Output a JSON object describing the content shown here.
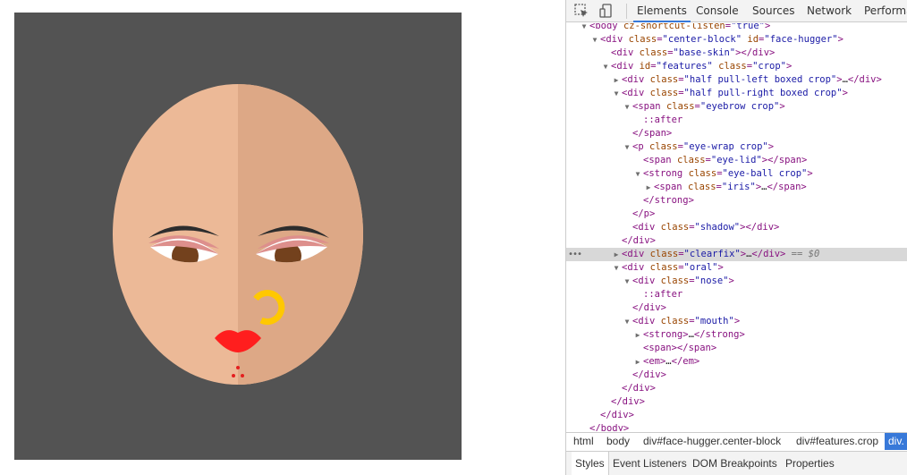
{
  "devtools": {
    "tabs": [
      {
        "label": "Elements",
        "active": true
      },
      {
        "label": "Console"
      },
      {
        "label": "Sources"
      },
      {
        "label": "Network"
      },
      {
        "label": "Performa"
      }
    ],
    "tree": [
      {
        "depth": 0,
        "arrow": "down",
        "parts": [
          [
            "tg",
            "<body "
          ],
          [
            "an",
            "cz-shortcut-listen"
          ],
          [
            "tg",
            "="
          ],
          [
            "av",
            "\"true\""
          ],
          [
            "tg",
            ">"
          ]
        ]
      },
      {
        "depth": 1,
        "arrow": "down",
        "parts": [
          [
            "tg",
            "<div "
          ],
          [
            "an",
            "class"
          ],
          [
            "tg",
            "="
          ],
          [
            "av",
            "\"center-block\""
          ],
          [
            "tg",
            " "
          ],
          [
            "an",
            "id"
          ],
          [
            "tg",
            "="
          ],
          [
            "av",
            "\"face-hugger\""
          ],
          [
            "tg",
            ">"
          ]
        ]
      },
      {
        "depth": 2,
        "arrow": "",
        "parts": [
          [
            "tg",
            "<div "
          ],
          [
            "an",
            "class"
          ],
          [
            "tg",
            "="
          ],
          [
            "av",
            "\"base-skin\""
          ],
          [
            "tg",
            "></div>"
          ]
        ]
      },
      {
        "depth": 2,
        "arrow": "down",
        "parts": [
          [
            "tg",
            "<div "
          ],
          [
            "an",
            "id"
          ],
          [
            "tg",
            "="
          ],
          [
            "av",
            "\"features\""
          ],
          [
            "tg",
            " "
          ],
          [
            "an",
            "class"
          ],
          [
            "tg",
            "="
          ],
          [
            "av",
            "\"crop\""
          ],
          [
            "tg",
            ">"
          ]
        ]
      },
      {
        "depth": 3,
        "arrow": "right",
        "parts": [
          [
            "tg",
            "<div "
          ],
          [
            "an",
            "class"
          ],
          [
            "tg",
            "="
          ],
          [
            "av",
            "\"half pull-left boxed crop\""
          ],
          [
            "tg",
            ">"
          ],
          [
            "pl",
            "…"
          ],
          [
            "tg",
            "</div>"
          ]
        ]
      },
      {
        "depth": 3,
        "arrow": "down",
        "parts": [
          [
            "tg",
            "<div "
          ],
          [
            "an",
            "class"
          ],
          [
            "tg",
            "="
          ],
          [
            "av",
            "\"half pull-right boxed crop\""
          ],
          [
            "tg",
            ">"
          ]
        ]
      },
      {
        "depth": 4,
        "arrow": "down",
        "parts": [
          [
            "tg",
            "<span "
          ],
          [
            "an",
            "class"
          ],
          [
            "tg",
            "="
          ],
          [
            "av",
            "\"eyebrow crop\""
          ],
          [
            "tg",
            ">"
          ]
        ]
      },
      {
        "depth": 5,
        "arrow": "",
        "parts": [
          [
            "ps",
            "::after"
          ]
        ]
      },
      {
        "depth": 4,
        "arrow": "",
        "parts": [
          [
            "tg",
            "</span>"
          ]
        ]
      },
      {
        "depth": 4,
        "arrow": "down",
        "parts": [
          [
            "tg",
            "<p "
          ],
          [
            "an",
            "class"
          ],
          [
            "tg",
            "="
          ],
          [
            "av",
            "\"eye-wrap crop\""
          ],
          [
            "tg",
            ">"
          ]
        ]
      },
      {
        "depth": 5,
        "arrow": "",
        "parts": [
          [
            "tg",
            "<span "
          ],
          [
            "an",
            "class"
          ],
          [
            "tg",
            "="
          ],
          [
            "av",
            "\"eye-lid\""
          ],
          [
            "tg",
            "></span>"
          ]
        ]
      },
      {
        "depth": 5,
        "arrow": "down",
        "parts": [
          [
            "tg",
            "<strong "
          ],
          [
            "an",
            "class"
          ],
          [
            "tg",
            "="
          ],
          [
            "av",
            "\"eye-ball crop\""
          ],
          [
            "tg",
            ">"
          ]
        ]
      },
      {
        "depth": 6,
        "arrow": "right",
        "parts": [
          [
            "tg",
            "<span "
          ],
          [
            "an",
            "class"
          ],
          [
            "tg",
            "="
          ],
          [
            "av",
            "\"iris\""
          ],
          [
            "tg",
            ">"
          ],
          [
            "pl",
            "…"
          ],
          [
            "tg",
            "</span>"
          ]
        ]
      },
      {
        "depth": 5,
        "arrow": "",
        "parts": [
          [
            "tg",
            "</strong>"
          ]
        ]
      },
      {
        "depth": 4,
        "arrow": "",
        "parts": [
          [
            "tg",
            "</p>"
          ]
        ]
      },
      {
        "depth": 4,
        "arrow": "",
        "parts": [
          [
            "tg",
            "<div "
          ],
          [
            "an",
            "class"
          ],
          [
            "tg",
            "="
          ],
          [
            "av",
            "\"shadow\""
          ],
          [
            "tg",
            "></div>"
          ]
        ]
      },
      {
        "depth": 3,
        "arrow": "",
        "parts": [
          [
            "tg",
            "</div>"
          ]
        ]
      },
      {
        "depth": 3,
        "arrow": "right",
        "selected": true,
        "parts": [
          [
            "tg",
            "<div "
          ],
          [
            "an",
            "class"
          ],
          [
            "tg",
            "="
          ],
          [
            "av",
            "\"clearfix\""
          ],
          [
            "tg",
            ">"
          ],
          [
            "pl",
            "…"
          ],
          [
            "tg",
            "</div>"
          ],
          [
            "pl",
            " == "
          ],
          [
            "pl",
            "$0"
          ]
        ]
      },
      {
        "depth": 3,
        "arrow": "down",
        "parts": [
          [
            "tg",
            "<div "
          ],
          [
            "an",
            "class"
          ],
          [
            "tg",
            "="
          ],
          [
            "av",
            "\"oral\""
          ],
          [
            "tg",
            ">"
          ]
        ]
      },
      {
        "depth": 4,
        "arrow": "down",
        "parts": [
          [
            "tg",
            "<div "
          ],
          [
            "an",
            "class"
          ],
          [
            "tg",
            "="
          ],
          [
            "av",
            "\"nose\""
          ],
          [
            "tg",
            ">"
          ]
        ]
      },
      {
        "depth": 5,
        "arrow": "",
        "parts": [
          [
            "ps",
            "::after"
          ]
        ]
      },
      {
        "depth": 4,
        "arrow": "",
        "parts": [
          [
            "tg",
            "</div>"
          ]
        ]
      },
      {
        "depth": 4,
        "arrow": "down",
        "parts": [
          [
            "tg",
            "<div "
          ],
          [
            "an",
            "class"
          ],
          [
            "tg",
            "="
          ],
          [
            "av",
            "\"mouth\""
          ],
          [
            "tg",
            ">"
          ]
        ]
      },
      {
        "depth": 5,
        "arrow": "right",
        "parts": [
          [
            "tg",
            "<strong>"
          ],
          [
            "pl",
            "…"
          ],
          [
            "tg",
            "</strong>"
          ]
        ]
      },
      {
        "depth": 5,
        "arrow": "",
        "parts": [
          [
            "tg",
            "<span></span>"
          ]
        ]
      },
      {
        "depth": 5,
        "arrow": "right",
        "parts": [
          [
            "tg",
            "<em>"
          ],
          [
            "pl",
            "…"
          ],
          [
            "tg",
            "</em>"
          ]
        ]
      },
      {
        "depth": 4,
        "arrow": "",
        "parts": [
          [
            "tg",
            "</div>"
          ]
        ]
      },
      {
        "depth": 3,
        "arrow": "",
        "parts": [
          [
            "tg",
            "</div>"
          ]
        ]
      },
      {
        "depth": 2,
        "arrow": "",
        "parts": [
          [
            "tg",
            "</div>"
          ]
        ]
      },
      {
        "depth": 1,
        "arrow": "",
        "parts": [
          [
            "tg",
            "</div>"
          ]
        ]
      },
      {
        "depth": 0,
        "arrow": "",
        "parts": [
          [
            "tg",
            "</body>"
          ]
        ]
      }
    ],
    "selection_dots": "•••",
    "breadcrumbs": [
      {
        "label": "html"
      },
      {
        "label": "body"
      },
      {
        "label": "div#face-hugger.center-block"
      },
      {
        "label": "div#features.crop"
      },
      {
        "label": "div.",
        "active": true
      }
    ],
    "subtabs": [
      {
        "label": "Styles",
        "active": true
      },
      {
        "label": "Event Listeners"
      },
      {
        "label": "DOM Breakpoints"
      },
      {
        "label": "Properties"
      }
    ],
    "colors": {
      "tag": "#881280",
      "attr_name": "#994500",
      "attr_value": "#1a1aa6",
      "active_tab": "#3879d9",
      "selected_row": "#d8d8d8"
    },
    "icons": [
      "inspect-element-icon",
      "device-toolbar-icon"
    ]
  },
  "face_canvas": {
    "colors": {
      "background": "#535353",
      "skin_left": "#ecb997",
      "skin_right": "#dda886",
      "eyebrow": "#2d2d2d",
      "eyelid": "#dd8f8c",
      "eye_white": "#ffffff",
      "iris": "#73411d",
      "nose_ring": "#ffc800",
      "lips": "#ff1e1e",
      "piercing_dots": "#e41f1f"
    }
  }
}
